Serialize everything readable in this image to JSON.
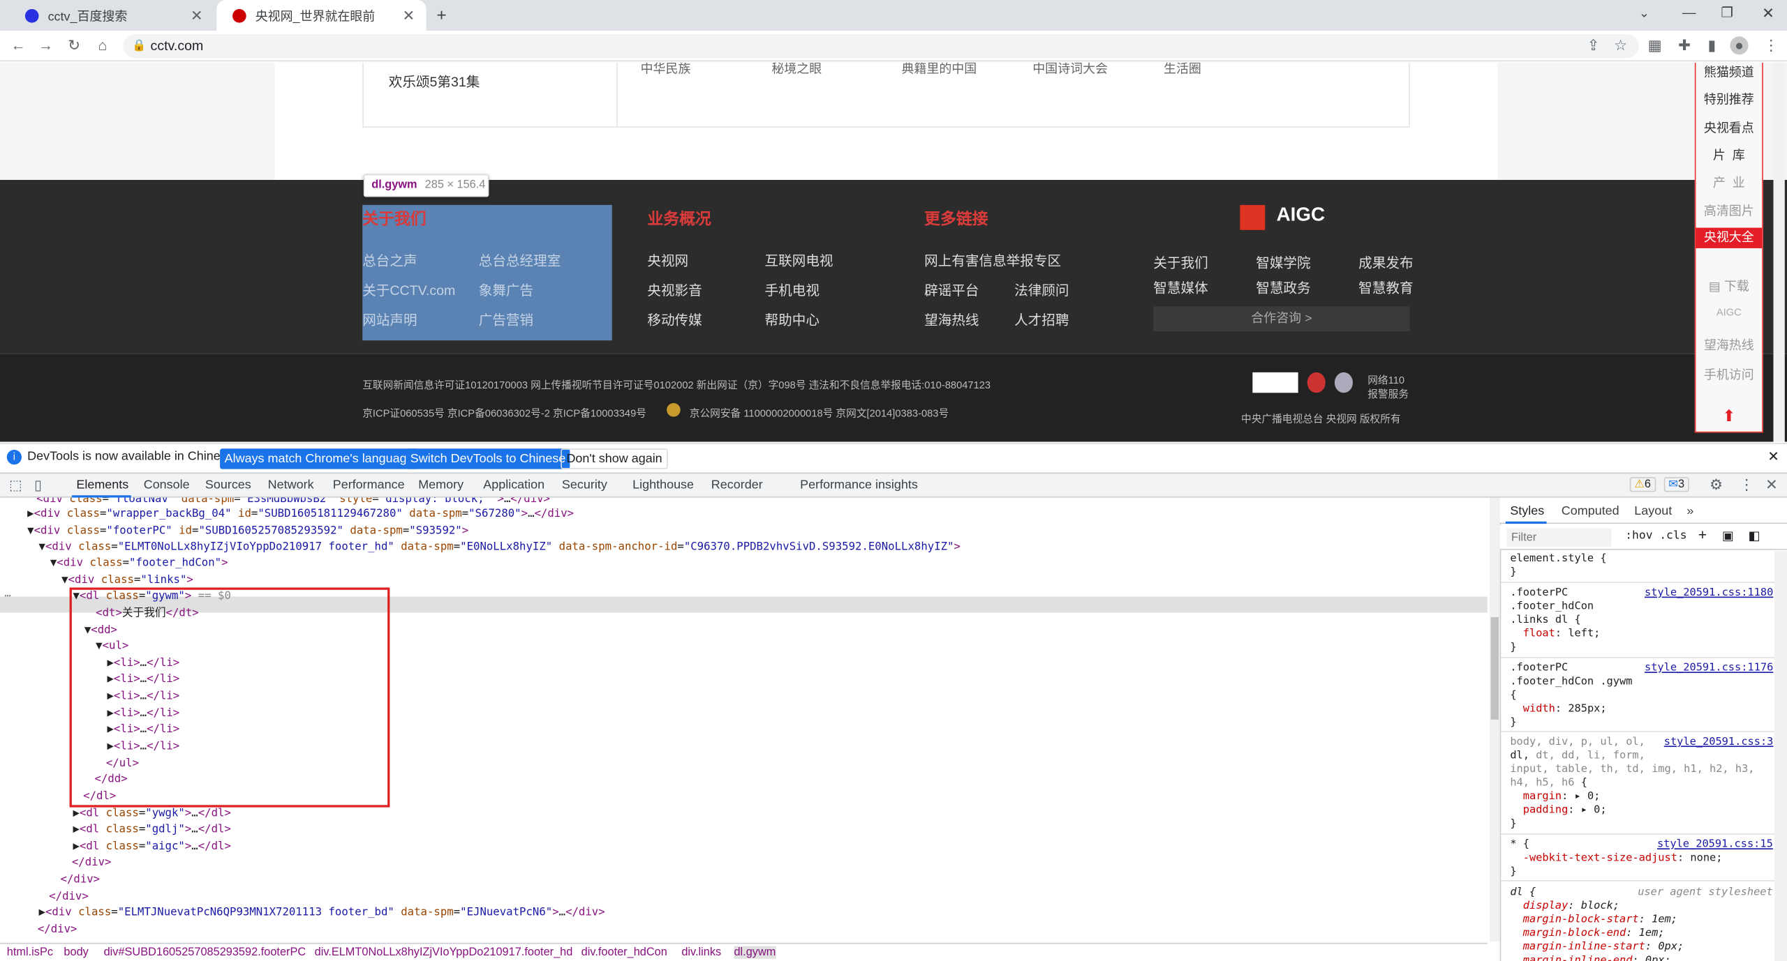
{
  "tabs": [
    {
      "title": "cctv_百度搜索"
    },
    {
      "title": "央视网_世界就在眼前"
    }
  ],
  "address": "cctv.com",
  "page": {
    "top_item": "欢乐颂5第31集",
    "top_cut": [
      "中华民族",
      "秘境之眼",
      "典籍里的中国",
      "中国诗词大会",
      "生活圈"
    ],
    "footer_heads": [
      "关于我们",
      "业务概况",
      "更多链接"
    ],
    "about": [
      "总台之声",
      "总台总经理室",
      "关于CCTV.com",
      "象舞广告",
      "网站声明",
      "广告营销"
    ],
    "business": [
      "央视网",
      "互联网电视",
      "央视影音",
      "手机电视",
      "移动传媒",
      "帮助中心"
    ],
    "links": [
      "网上有害信息举报专区",
      "辟谣平台",
      "法律顾问",
      "望海热线",
      "人才招聘"
    ],
    "aigc_label": "AIGC",
    "aigc_items": [
      "关于我们",
      "智媒学院",
      "成果发布",
      "智慧媒体",
      "智慧政务",
      "智慧教育"
    ],
    "aigc_button": "合作咨询 >",
    "license1": "互联网新闻信息许可证10120170003  网上传播视听节目许可证号0102002  新出网证（京）字098号  违法和不良信息举报电话:010-88047123",
    "license2": "京ICP证060535号  京ICP备06036302号-2  京ICP备10003349号",
    "license3": "京公网安备 11000002000018号  京网文[2014]0383-083号",
    "police": "网络110\n报警服务",
    "copyright": "中央广播电视总台  央视网  版权所有",
    "sidebar": [
      "熊猫频道",
      "特别推荐",
      "央视看点",
      "片  库",
      "产  业",
      "高清图片",
      "央视大全",
      "下载",
      "AIGC",
      "望海热线",
      "手机访问"
    ],
    "tooltip_name": "dl.gywm",
    "tooltip_size": "285 × 156.4"
  },
  "notice": {
    "text": "DevTools is now available in Chinese!",
    "b1": "Always match Chrome's language",
    "b2": "Switch DevTools to Chinese",
    "b3": "Don't show again"
  },
  "devtools_tabs": [
    "Elements",
    "Console",
    "Sources",
    "Network",
    "Performance",
    "Memory",
    "Application",
    "Security",
    "Lighthouse",
    "Recorder",
    "Performance insights"
  ],
  "badges": {
    "warn": "6",
    "info": "3"
  },
  "styles_tabs": [
    "Styles",
    "Computed",
    "Layout"
  ],
  "filter_placeholder": "Filter",
  "hov": ":hov",
  "cls": ".cls",
  "breadcrumbs": [
    "html.isPc",
    "body",
    "div#SUBD1605257085293592.footerPC",
    "div.ELMT0NoLLx8hyIZjVIoYppDo210917.footer_hd",
    "div.footer_hdCon",
    "div.links",
    "dl.gywm"
  ]
}
